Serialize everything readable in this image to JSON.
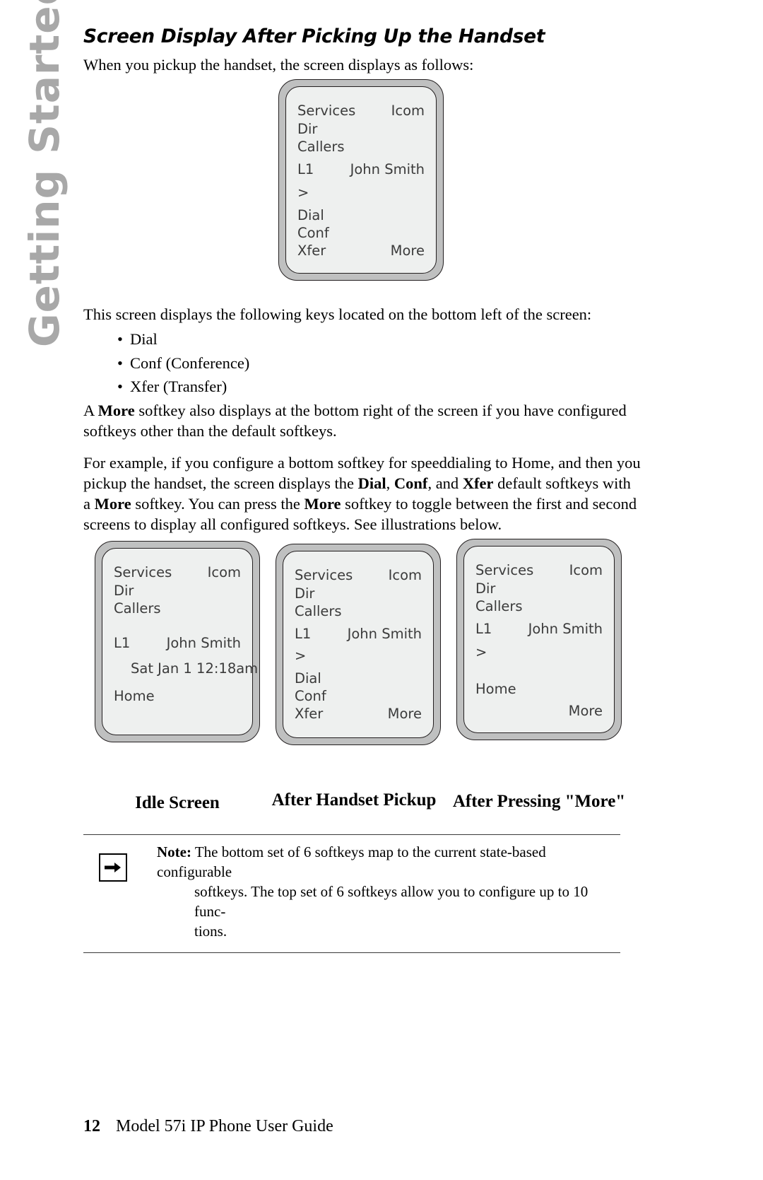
{
  "sidebar": {
    "tab_label": "Getting Started",
    "tab_color": "#a8a8a8"
  },
  "page": {
    "section_title": "Screen Display After Picking Up the Handset",
    "intro_paragraph": "When you pickup the handset, the screen displays as follows:",
    "keys_paragraph": "This screen displays the following keys located on the bottom left of the screen:",
    "bullets": [
      {
        "bullet": "•",
        "text": "Dial"
      },
      {
        "bullet": "•",
        "text": "Conf (Conference)"
      },
      {
        "bullet": "•",
        "text": "Xfer (Transfer)"
      }
    ]
  },
  "paragraphs": {
    "more_softkey": {
      "part1": "A ",
      "bold1": "More",
      "part2": " softkey also displays at the bottom right of the screen if you have configured softkeys other than the default softkeys."
    },
    "example": {
      "part1": "For example, if you configure a bottom softkey for speeddialing to Home, and then you pickup the handset, the screen displays the ",
      "bold1": "Dial",
      "part2": ", ",
      "bold2": "Conf",
      "part3": ", and ",
      "bold3": "Xfer",
      "part4": " default softkeys with a ",
      "bold4": "More",
      "part5": " softkey. You can press the ",
      "bold5": "More",
      "part6": " softkey to toggle between the first and second screens to display all configured softkeys. See illustrations below."
    }
  },
  "phone_main": {
    "softkey_top_left_1": "Services",
    "softkey_top_right_1": "Icom",
    "softkey_top_left_2": "Dir",
    "softkey_top_left_3": "Callers",
    "line_label": "L1",
    "caller_name": "John Smith",
    "prompt": ">",
    "softkey_bottom_left_1": "Dial",
    "softkey_bottom_left_2": "Conf",
    "softkey_bottom_left_3": "Xfer",
    "softkey_bottom_right_3": "More"
  },
  "phone_idle": {
    "softkey_top_left_1": "Services",
    "softkey_top_right_1": "Icom",
    "softkey_top_left_2": "Dir",
    "softkey_top_left_3": "Callers",
    "line_label": "L1",
    "caller_name": "John Smith",
    "datetime": "Sat  Jan 1  12:18am",
    "softkey_bottom_left_1": "Home",
    "caption": "Idle Screen"
  },
  "phone_pickup": {
    "softkey_top_left_1": "Services",
    "softkey_top_right_1": "Icom",
    "softkey_top_left_2": "Dir",
    "softkey_top_left_3": "Callers",
    "line_label": "L1",
    "caller_name": "John Smith",
    "prompt": ">",
    "softkey_bottom_left_1": "Dial",
    "softkey_bottom_left_2": "Conf",
    "softkey_bottom_left_3": "Xfer",
    "softkey_bottom_right_3": "More",
    "caption": "After Handset Pickup"
  },
  "phone_more": {
    "softkey_top_left_1": "Services",
    "softkey_top_right_1": "Icom",
    "softkey_top_left_2": "Dir",
    "softkey_top_left_3": "Callers",
    "line_label": "L1",
    "caller_name": "John Smith",
    "prompt": ">",
    "softkey_bottom_left_1": "Home",
    "softkey_bottom_right_3": "More",
    "caption": "After Pressing \"More\""
  },
  "note": {
    "icon": "arrow-right-icon",
    "label": "Note:",
    "line1": " The bottom set of 6 softkeys map to the current state-based configurable",
    "line2": "softkeys. The top set of 6 softkeys allow you to configure up to 10 func-",
    "line3": "tions."
  },
  "footer": {
    "page_number": "12",
    "guide_title": "Model 57i IP Phone User Guide"
  }
}
